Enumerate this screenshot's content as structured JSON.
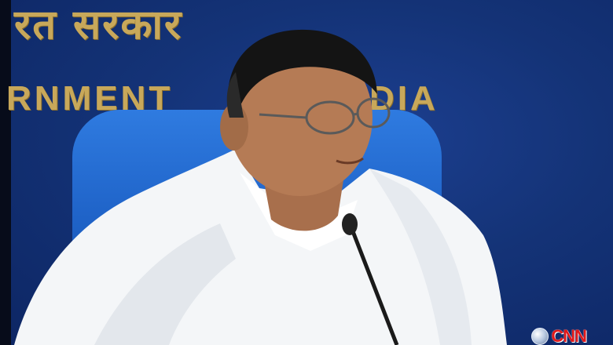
{
  "signage": {
    "line1": "रत सरकार",
    "line2_left": "RNMENT",
    "line2_right": "DIA"
  },
  "broadcast_logo": {
    "text": "CNN",
    "icon": "globe-icon"
  },
  "colors": {
    "backdrop": "#143377",
    "sign_gold": "#c8a85a",
    "chair_blue": "#2f7be0",
    "shawl_white": "#f4f6f8",
    "logo_red": "#e0191b"
  }
}
